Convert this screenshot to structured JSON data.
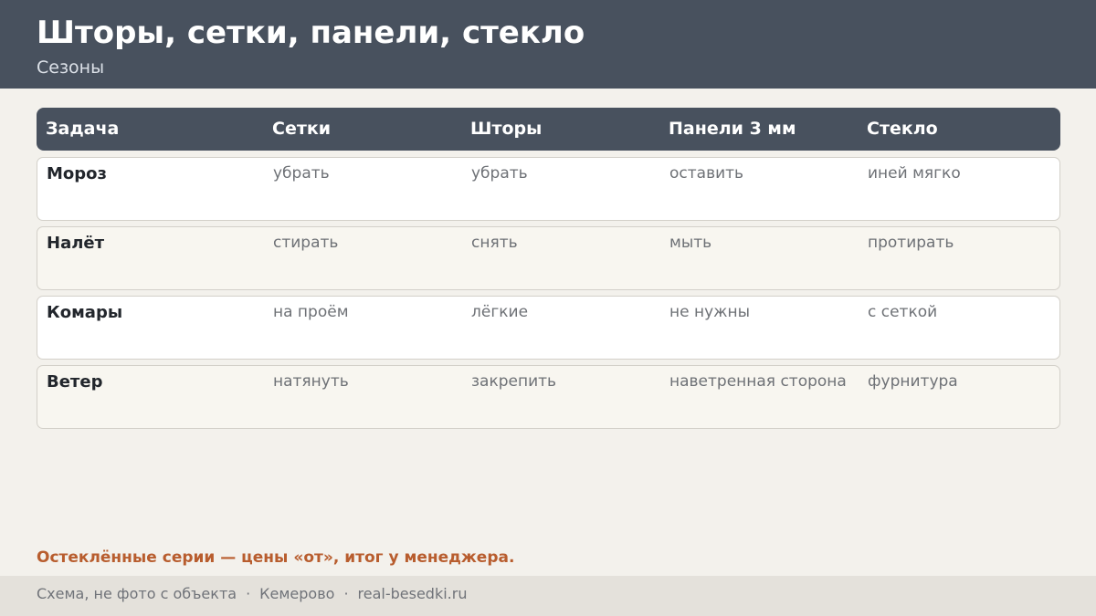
{
  "header": {
    "title": "Шторы, сетки, панели, стекло",
    "subtitle": "Сезоны"
  },
  "table": {
    "columns": [
      "Задача",
      "Сетки",
      "Шторы",
      "Панели 3 мм",
      "Стекло"
    ],
    "rows": [
      {
        "label": "Мороз",
        "values": [
          "убрать",
          "убрать",
          "оставить",
          "иней мягко"
        ]
      },
      {
        "label": "Налёт",
        "values": [
          "стирать",
          "снять",
          "мыть",
          "протирать"
        ]
      },
      {
        "label": "Комары",
        "values": [
          "на проём",
          "лёгкие",
          "не нужны",
          "с сеткой"
        ]
      },
      {
        "label": "Ветер",
        "values": [
          "натянуть",
          "закрепить",
          "наветренная сторона",
          "фурнитура"
        ]
      }
    ]
  },
  "note": "Остеклённые серии — цены «от», итог у менеджера.",
  "footer": {
    "parts": [
      "Схема, не фото с объекта",
      "Кемерово",
      "real-besedki.ru"
    ],
    "separator": "·"
  },
  "colors": {
    "header_bg": "#48515e",
    "accent": "#b85d2e",
    "page_bg": "#f3f1ec",
    "footer_bg": "#e4e1db"
  }
}
